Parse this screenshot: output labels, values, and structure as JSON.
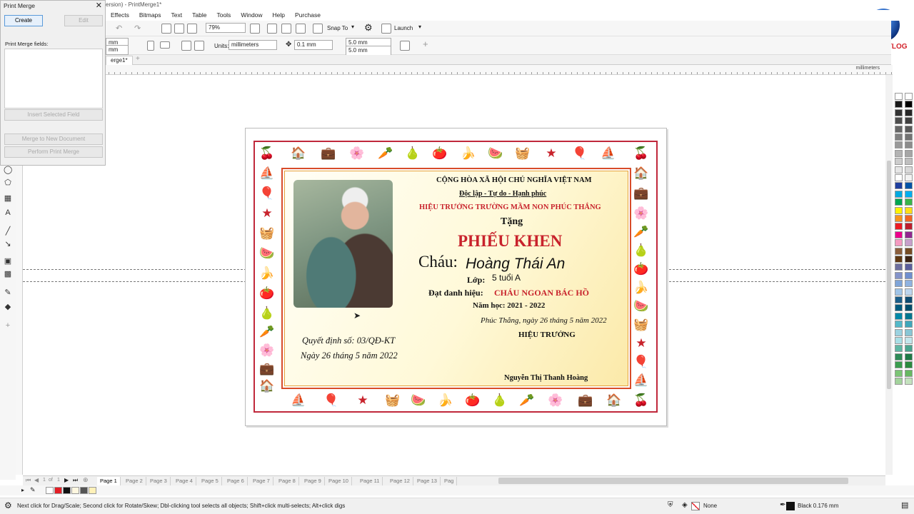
{
  "window": {
    "title": "ersion) - PrintMerge1*",
    "controls": [
      "—",
      "❐",
      "✕"
    ]
  },
  "menu": [
    "Effects",
    "Bitmaps",
    "Text",
    "Table",
    "Tools",
    "Window",
    "Help",
    "Purchase"
  ],
  "toolbar": {
    "zoom": "79%",
    "snap_to": "Snap To",
    "launch": "Launch",
    "width_field": "mm",
    "height_field": "mm",
    "units_label": "Units:",
    "units_value": "millimeters",
    "nudge_value": "0.1 mm",
    "dup_x": "5.0 mm",
    "dup_y": "5.0 mm"
  },
  "doc_tab": "erge1*",
  "ruler_unit": "millimeters",
  "print_merge": {
    "title": "Print Merge",
    "create_label": "Create",
    "edit_label": "Edit",
    "fields_label": "Print Merge fields:",
    "insert_label": "Insert Selected Field",
    "merge_new_doc_label": "Merge to New Document",
    "perform_label": "Perform Print Merge"
  },
  "certificate": {
    "country": "CỘNG HÒA XÃ HỘI CHỦ NGHĨA VIỆT NAM",
    "motto": "Độc lập - Tự do - Hạnh phúc",
    "issuer": "HIỆU TRƯỞNG TRƯỜNG MẦM NON PHÚC THẮNG",
    "presents": "Tặng",
    "heading": "PHIẾU KHEN",
    "child_label": "Cháu:",
    "child_name": "Hoàng Thái An",
    "class_label": "Lớp:",
    "class_value": "5 tuổi A",
    "title_label": "Đạt danh hiệu:",
    "title_value": "CHÁU NGOAN BÁC HỒ",
    "year": "Năm học: 2021 - 2022",
    "place_date": "Phúc Thắng, ngày 26 tháng 5 năm 2022",
    "signer_title": "HIỆU TRƯỞNG",
    "signer_name": "Nguyễn Thị Thanh Hoàng",
    "decision_no": "Quyết định số: 03/QĐ-KT",
    "decision_date": "Ngày 26 tháng 5 năm 2022"
  },
  "page_nav": {
    "current": "1",
    "of": "of",
    "total": "1"
  },
  "pages": [
    "Page 1",
    "Page 2",
    "Page 3",
    "Page 4",
    "Page 5",
    "Page 6",
    "Page 7",
    "Page 8",
    "Page 9",
    "Page 10",
    "Page 11",
    "Page 12",
    "Page 13",
    "Pag"
  ],
  "status": {
    "hint": "Next click for Drag/Scale; Second click for Rotate/Skew; Dbl-clicking tool selects all objects; Shift+click multi-selects; Alt+click digs",
    "fill": "None",
    "outline": "Black  0.176 mm"
  },
  "logo": {
    "text": "BHTH VTLOG"
  },
  "colors": {
    "accent_red": "#c8232c",
    "border_red": "#c0283b",
    "status_bg": "#f0f0f0"
  }
}
